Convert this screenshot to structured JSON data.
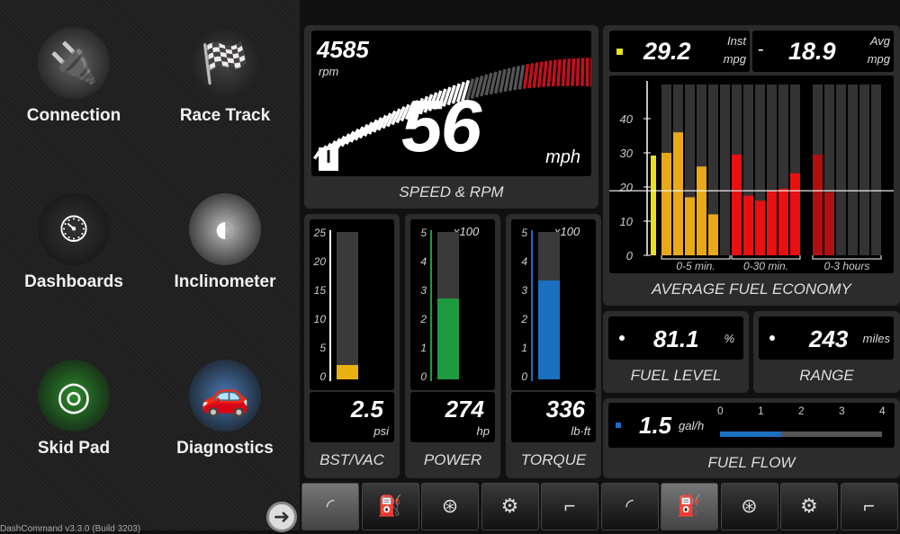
{
  "apps": [
    {
      "label": "Connection",
      "icon": "obd-connector-icon",
      "glyph": "🔌"
    },
    {
      "label": "Race Track",
      "icon": "race-car-icon",
      "glyph": "🏁"
    },
    {
      "label": "Dashboards",
      "icon": "gauges-icon",
      "glyph": "⏲"
    },
    {
      "label": "Inclinometer",
      "icon": "inclinometer-icon",
      "glyph": "◐"
    },
    {
      "label": "Skid Pad",
      "icon": "skid-pad-icon",
      "glyph": "◎"
    },
    {
      "label": "Diagnostics",
      "icon": "car-warning-icon",
      "glyph": "🚗"
    }
  ],
  "version": "DashCommand v3.3.0 (Build 3203)",
  "speed": {
    "rpm": "4585",
    "rpm_unit": "rpm",
    "speed": "56",
    "speed_unit": "mph",
    "gear": "I",
    "caption": "SPEED & RPM",
    "rpm_fraction": 0.55
  },
  "economy": {
    "inst": "29.2",
    "inst_unit1": "Inst",
    "inst_unit2": "mpg",
    "avg": "18.9",
    "avg_unit1": "Avg",
    "avg_unit2": "mpg",
    "dash": "-",
    "caption": "AVERAGE FUEL ECONOMY",
    "groups": [
      "0-5 min.",
      "0-30 min.",
      "0-3 hours"
    ],
    "yticks": [
      "40",
      "30",
      "20",
      "10",
      "0"
    ]
  },
  "chart_data": {
    "type": "bar",
    "ylim": [
      0,
      50
    ],
    "yticks": [
      0,
      10,
      20,
      30,
      40
    ],
    "inst_value": 29.2,
    "avg_line": 18.9,
    "series": [
      {
        "name": "0-5 min.",
        "values": [
          30,
          36,
          17,
          26,
          12,
          null
        ]
      },
      {
        "name": "0-30 min.",
        "values": [
          29.5,
          17.5,
          16,
          19,
          19.5,
          24
        ]
      },
      {
        "name": "0-3 hours",
        "values": [
          29.5,
          18.5,
          null,
          null,
          null,
          null
        ]
      }
    ],
    "colors": {
      "inst": "#e8e020",
      "0-5 min.": "#e8a818",
      "0-30 min.": "#e81010",
      "0-3 hours": "#b01010"
    }
  },
  "gauges": [
    {
      "value": "2.5",
      "unit": "psi",
      "caption": "BST/VAC",
      "ticks": [
        "25",
        "20",
        "15",
        "10",
        "5",
        "0"
      ],
      "mult": "",
      "fraction": 0.1,
      "color": "#e8b010"
    },
    {
      "value": "274",
      "unit": "hp",
      "caption": "POWER",
      "ticks": [
        "5",
        "4",
        "3",
        "2",
        "1",
        "0"
      ],
      "mult": "x100",
      "fraction": 0.55,
      "color": "#1e9a40"
    },
    {
      "value": "336",
      "unit": "lb·ft",
      "caption": "TORQUE",
      "ticks": [
        "5",
        "4",
        "3",
        "2",
        "1",
        "0"
      ],
      "mult": "x100",
      "fraction": 0.67,
      "color": "#1a6fc0"
    }
  ],
  "fuel_level": {
    "value": "81.1",
    "unit": "%",
    "caption": "FUEL LEVEL"
  },
  "range": {
    "value": "243",
    "unit": "miles",
    "caption": "RANGE"
  },
  "fuel_flow": {
    "value": "1.5",
    "unit": "gal/h",
    "caption": "FUEL FLOW",
    "ticks": [
      "0",
      "1",
      "2",
      "3",
      "4"
    ],
    "fraction": 0.375
  },
  "tabs": [
    {
      "icon": "speedometer-icon",
      "glyph": "◜",
      "selected": true
    },
    {
      "icon": "fuel-pump-icon",
      "glyph": "⛽"
    },
    {
      "icon": "steering-wheel-icon",
      "glyph": "⊛"
    },
    {
      "icon": "engine-icon",
      "glyph": "⚙"
    },
    {
      "icon": "fuel-nozzle-icon",
      "glyph": "⌐"
    },
    {
      "icon": "speedometer-icon",
      "glyph": "◜"
    },
    {
      "icon": "fuel-pump-icon",
      "glyph": "⛽",
      "selected": true
    },
    {
      "icon": "steering-wheel-icon",
      "glyph": "⊛"
    },
    {
      "icon": "engine-icon",
      "glyph": "⚙"
    },
    {
      "icon": "fuel-nozzle-icon",
      "glyph": "⌐"
    }
  ]
}
